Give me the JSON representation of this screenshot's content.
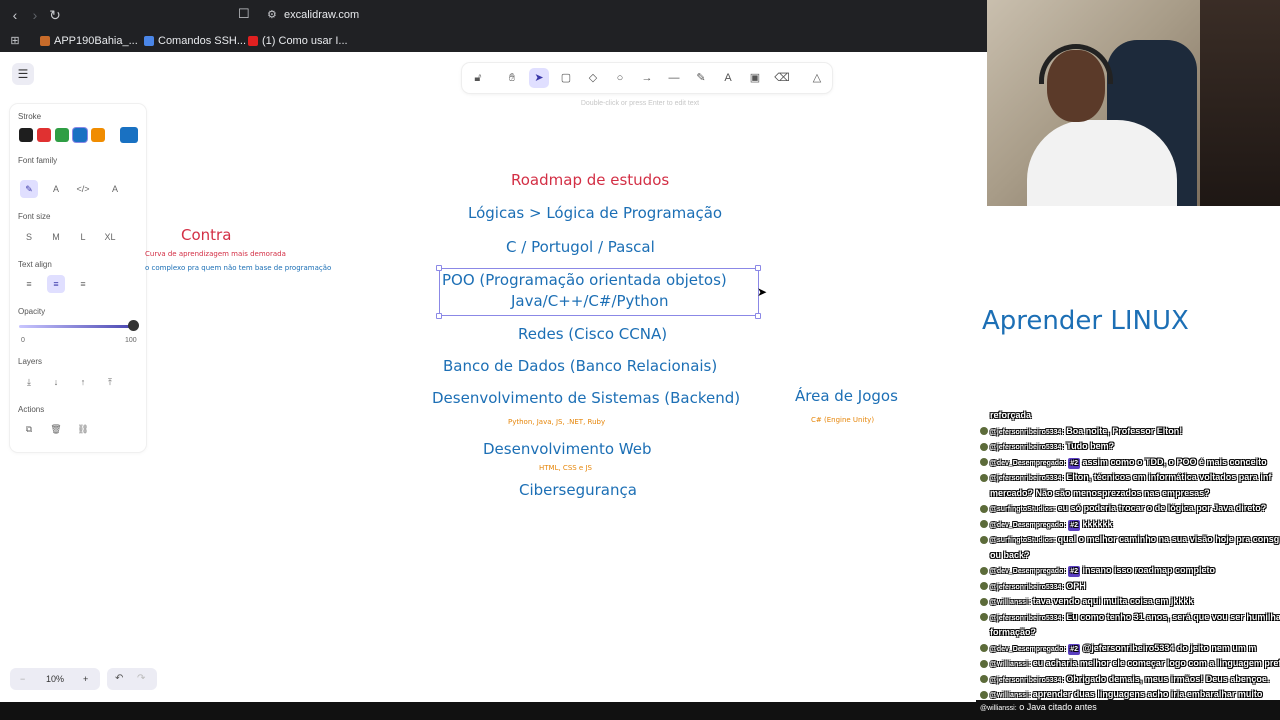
{
  "browser": {
    "url": "excalidraw.com",
    "bookmarks": [
      "APP190Bahia_...",
      "Comandos SSH...",
      "(1) Como usar I..."
    ]
  },
  "toolbar": {
    "hint": "Double-click or press Enter to edit text",
    "tools": [
      "lock-icon",
      "hand-icon",
      "pointer-icon",
      "rectangle-icon",
      "diamond-icon",
      "ellipse-icon",
      "arrow-icon",
      "line-icon",
      "pencil-icon",
      "text-icon",
      "image-icon",
      "eraser-icon",
      "extra-tools-icon"
    ]
  },
  "panel": {
    "stroke_label": "Stroke",
    "stroke_colors": [
      "#1e1e1e",
      "#e03131",
      "#2f9e44",
      "#1971c2",
      "#f08c00"
    ],
    "current_stroke": "#1971c2",
    "font_family_label": "Font family",
    "font_size_label": "Font size",
    "font_sizes": [
      "S",
      "M",
      "L",
      "XL"
    ],
    "text_align_label": "Text align",
    "opacity_label": "Opacity",
    "opacity_min": "0",
    "opacity_max": "100",
    "opacity_value": 100,
    "layers_label": "Layers",
    "actions_label": "Actions"
  },
  "zoom": {
    "minus": "−",
    "level": "10%",
    "plus": "+"
  },
  "canvas": {
    "roadmap_title": "Roadmap de estudos",
    "items": [
      "Lógicas > Lógica de Programação",
      "C / Portugol / Pascal",
      "POO (Programação orientada objetos)",
      "Java/C++/C#/Python",
      "Redes (Cisco CCNA)",
      "Banco de Dados (Banco Relacionais)",
      "Desenvolvimento de Sistemas (Backend)",
      "Python, Java, JS, .NET, Ruby",
      "Desenvolvimento Web",
      "HTML, CSS e JS",
      "Cibersegurança"
    ],
    "contra_title": "Contra",
    "contra_lines": [
      "Curva de aprendizagem mais demorada",
      "o complexo pra quem não tem base de programação"
    ],
    "jogos_title": "Área de Jogos",
    "jogos_sub": "C# (Engine Unity)",
    "linux": "Aprender LINUX"
  },
  "chat": {
    "messages": [
      {
        "user": "",
        "text": "reforçada"
      },
      {
        "user": "@jefersonribeiro5334:",
        "text": "Boa noite, Professor Elton!"
      },
      {
        "user": "@jefersonribeiro5334:",
        "text": "Tudo bem?"
      },
      {
        "user": "@dev_Desempregado:",
        "badge": "#2",
        "text": "assim como o TDD, o POO é mais conceito"
      },
      {
        "user": "@jefersonribeiro5334:",
        "text": "Elton, técnicos em informática voltados para inf"
      },
      {
        "user": "",
        "text": "mercado? Não são menosprezados nas empresas?"
      },
      {
        "user": "@surfingtoStudios:",
        "text": "eu só poderia trocar o de lógica por Java direto?"
      },
      {
        "user": "@dev_Desempregado:",
        "badge": "#2",
        "text": "kkkkkk"
      },
      {
        "user": "@surfingtoStudios:",
        "text": "qual o melhor caminho na sua visão hoje pra consg"
      },
      {
        "user": "",
        "text": "ou back?"
      },
      {
        "user": "@dev_Desempregado:",
        "badge": "#2",
        "text": "insano isso roadmap completo"
      },
      {
        "user": "@jefersonribeiro5334:",
        "text": "OPH"
      },
      {
        "user": "@willianssi:",
        "text": "tava vendo aqui muita coisa em jkkkk"
      },
      {
        "user": "@jefersonribeiro5334:",
        "text": "Eu como tenho 31 anos, será que vou ser humilha"
      },
      {
        "user": "",
        "text": "formação?"
      },
      {
        "user": "@dev_Desempregado:",
        "badge": "#2",
        "text": "@jefersonribeiro5334 do jeito nem um m"
      },
      {
        "user": "@willianssi:",
        "text": "eu acharia melhor ele começar logo com a linguagem pref"
      },
      {
        "user": "@jefersonribeiro5334:",
        "text": "Obrigado demais, meus irmãos! Deus abençoe."
      },
      {
        "user": "@willianssi:",
        "text": "aprender duas linguagens acho iria embaralhar muito"
      }
    ],
    "footer_user": "@willianssi:",
    "footer_text": "o Java citado antes"
  }
}
